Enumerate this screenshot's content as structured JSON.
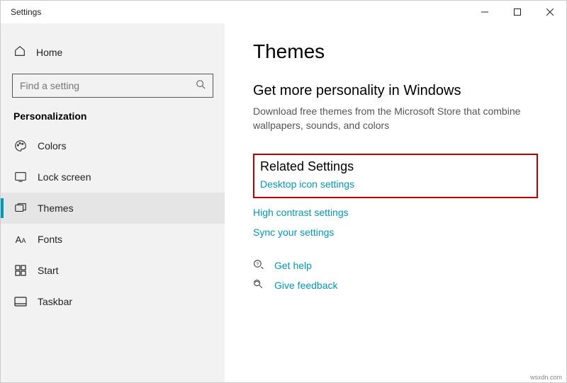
{
  "titlebar": {
    "app": "Settings"
  },
  "sidebar": {
    "home": "Home",
    "search_placeholder": "Find a setting",
    "section": "Personalization",
    "items": [
      {
        "label": "Colors"
      },
      {
        "label": "Lock screen"
      },
      {
        "label": "Themes"
      },
      {
        "label": "Fonts"
      },
      {
        "label": "Start"
      },
      {
        "label": "Taskbar"
      }
    ]
  },
  "main": {
    "title": "Themes",
    "store_heading": "Get more personality in Windows",
    "store_desc": "Download free themes from the Microsoft Store that combine wallpapers, sounds, and colors",
    "related_heading": "Related Settings",
    "link_desktop_icon": "Desktop icon settings",
    "link_high_contrast": "High contrast settings",
    "link_sync": "Sync your settings",
    "link_help": "Get help",
    "link_feedback": "Give feedback"
  },
  "attribution": "wsxdn.com"
}
